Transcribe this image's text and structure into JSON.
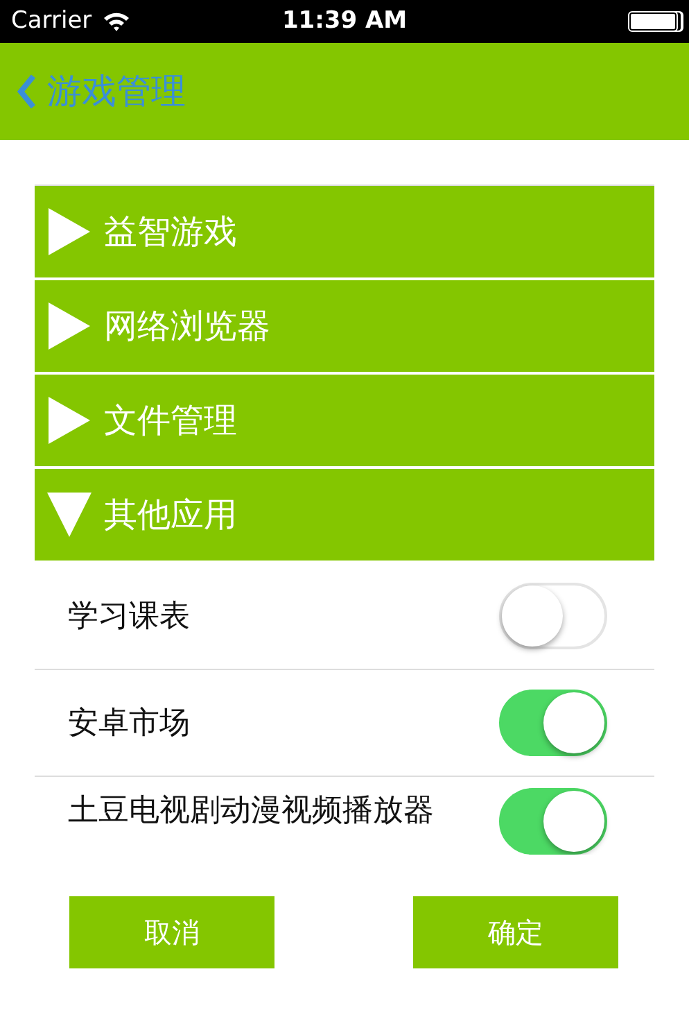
{
  "status_bar": {
    "carrier": "Carrier",
    "time": "11:39 AM"
  },
  "nav_bar": {
    "back_title": "游戏管理"
  },
  "groups": [
    {
      "label": "益智游戏",
      "expanded": false
    },
    {
      "label": "网络浏览器",
      "expanded": false
    },
    {
      "label": "文件管理",
      "expanded": false
    },
    {
      "label": "其他应用",
      "expanded": true,
      "children": [
        {
          "label": "学习课表",
          "on": false
        },
        {
          "label": "安卓市场",
          "on": true
        },
        {
          "label": "土豆电视剧动漫视频播放器",
          "on": true
        }
      ]
    }
  ],
  "buttons": [
    "取消",
    "确定"
  ]
}
